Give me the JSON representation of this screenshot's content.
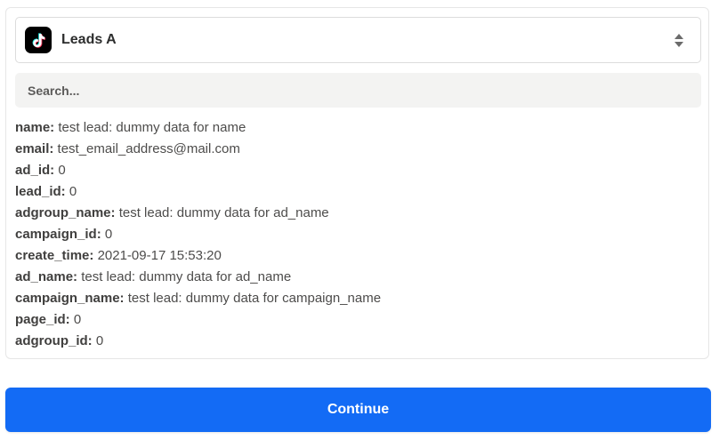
{
  "selector": {
    "app_icon": "tiktok-logo-icon",
    "label": "Leads A",
    "chevron_icon": "sort-chevrons-icon"
  },
  "search": {
    "placeholder": "Search..."
  },
  "fields": [
    {
      "key": "name:",
      "value": "test lead: dummy data for name"
    },
    {
      "key": "email:",
      "value": "test_email_address@mail.com"
    },
    {
      "key": "ad_id:",
      "value": "0"
    },
    {
      "key": "lead_id:",
      "value": "0"
    },
    {
      "key": "adgroup_name:",
      "value": "test lead: dummy data for ad_name"
    },
    {
      "key": "campaign_id:",
      "value": "0"
    },
    {
      "key": "create_time:",
      "value": "2021-09-17 15:53:20"
    },
    {
      "key": "ad_name:",
      "value": "test lead: dummy data for ad_name"
    },
    {
      "key": "campaign_name:",
      "value": "test lead: dummy data for campaign_name"
    },
    {
      "key": "page_id:",
      "value": "0"
    },
    {
      "key": "adgroup_id:",
      "value": "0"
    }
  ],
  "continue": {
    "label": "Continue"
  },
  "colors": {
    "primary": "#136bf5",
    "search_bg": "#f3f3f2",
    "border": "#e6e6e6"
  }
}
